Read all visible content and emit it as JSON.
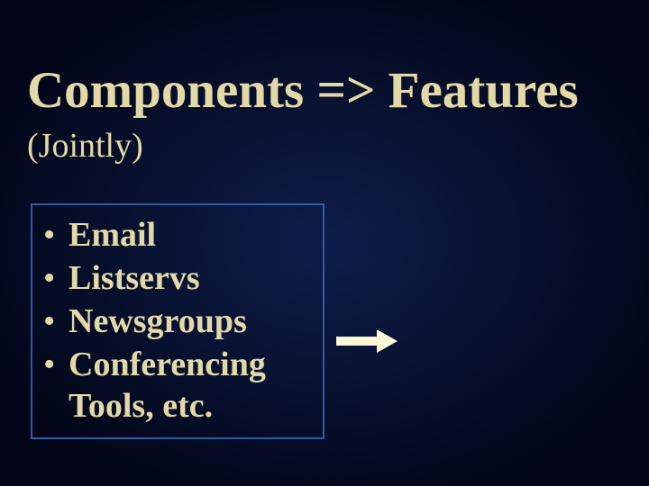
{
  "title": "Components => Features",
  "subtitle": "(Jointly)",
  "items": [
    "Email",
    "Listservs",
    "Newsgroups",
    "Conferencing Tools, etc."
  ]
}
